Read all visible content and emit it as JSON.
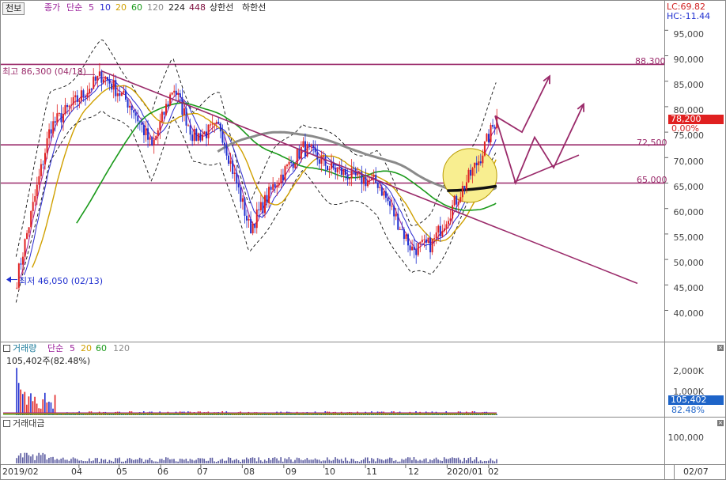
{
  "legend": {
    "toggle_button": "천보",
    "price_type": "종가",
    "ma_type": "단순",
    "periods": [
      "5",
      "10",
      "20",
      "60",
      "120",
      "224",
      "448"
    ],
    "period_colors": [
      "#9a1f9a",
      "#2a2ad0",
      "#d0a000",
      "#1a9a1a",
      "#8a8a8a",
      "#222222",
      "#7a0a3a"
    ],
    "upper_limit": "상한선",
    "lower_limit": "하한선"
  },
  "indicators": {
    "lc": "LC:69.82",
    "hc": "HC:-11.44"
  },
  "price_panel": {
    "y_ticks": [
      "95,000",
      "90,000",
      "85,000",
      "80,000",
      "75,000",
      "70,000",
      "65,000",
      "60,000",
      "55,000",
      "50,000",
      "45,000",
      "40,000"
    ],
    "high_annotation": "최고 86,300 (04/18)",
    "low_annotation": "최저 46,050 (02/13)",
    "current_price": "78,200",
    "current_change": "0.00%",
    "level_labels": [
      "88,300",
      "72,500",
      "65,000"
    ]
  },
  "volume_panel": {
    "title": "거래량",
    "ma_type": "단순",
    "periods": [
      "5",
      "20",
      "60",
      "120"
    ],
    "period_colors": [
      "#9a1f9a",
      "#d0a000",
      "#1a9a1a",
      "#8a8a8a"
    ],
    "current": "105,402주(82.48%)",
    "y_ticks": [
      "2,000K",
      "1,000K"
    ],
    "badge_value": "105,402",
    "badge_pct": "82.48%"
  },
  "amount_panel": {
    "title": "거래대금",
    "y_ticks": [
      "100,000"
    ]
  },
  "x_axis": {
    "labels": [
      "2019/02",
      "04",
      "05",
      "06",
      "07",
      "08",
      "09",
      "10",
      "11",
      "12",
      "2020/01",
      "02"
    ],
    "right_label": "02/07"
  },
  "colors": {
    "up": "#e02020",
    "down": "#2030d0",
    "annotation": "#9a2a6a",
    "highlight": "#f8ee90"
  },
  "chart_data": {
    "type": "candlestick",
    "x_range": [
      "2019/02",
      "2020/02/07"
    ],
    "ylim": [
      36000,
      98000
    ],
    "horizontal_levels": [
      88300,
      72500,
      65000
    ],
    "price_anchors": [
      [
        "2019/02/13",
        46050
      ],
      [
        "2019/03/10",
        76000
      ],
      [
        "2019/04/18",
        86300
      ],
      [
        "2019/05/10",
        80000
      ],
      [
        "2019/05/25",
        72000
      ],
      [
        "2019/06/10",
        84000
      ],
      [
        "2019/06/25",
        74000
      ],
      [
        "2019/07/15",
        76000
      ],
      [
        "2019/08/06",
        56000
      ],
      [
        "2019/08/25",
        65000
      ],
      [
        "2019/09/15",
        72000
      ],
      [
        "2019/10/05",
        68000
      ],
      [
        "2019/10/25",
        66000
      ],
      [
        "2019/11/10",
        65000
      ],
      [
        "2019/12/05",
        52000
      ],
      [
        "2019/12/20",
        53000
      ],
      [
        "2020/01/10",
        63000
      ],
      [
        "2020/01/25",
        70000
      ],
      [
        "2020/02/07",
        78200
      ]
    ],
    "high": {
      "date": "2019/04/18",
      "value": 86300
    },
    "low": {
      "date": "2019/02/13",
      "value": 46050
    },
    "last": {
      "date": "2020/02/07",
      "value": 78200,
      "change_pct": 0.0
    },
    "volume_last": 105402,
    "volume_last_pct": 82.48
  }
}
